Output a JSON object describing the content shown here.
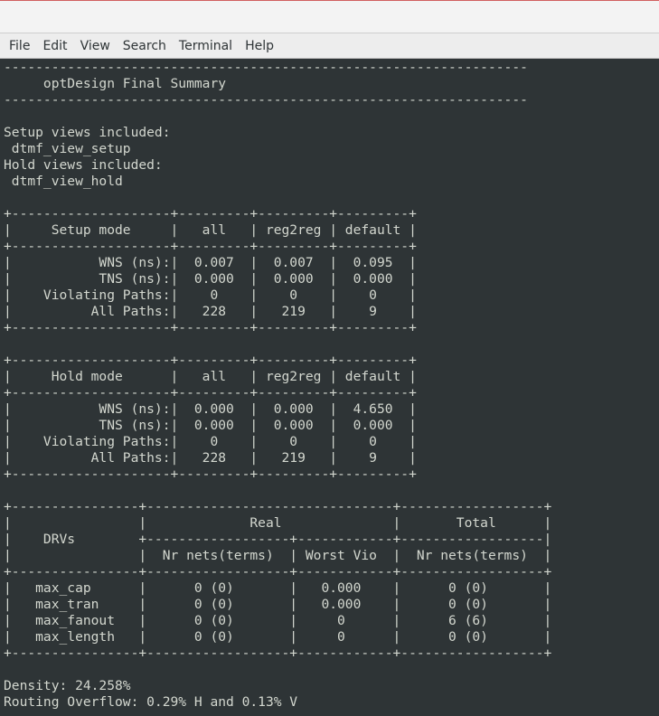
{
  "menu": {
    "items": [
      {
        "label": "File"
      },
      {
        "label": "Edit"
      },
      {
        "label": "View"
      },
      {
        "label": "Search"
      },
      {
        "label": "Terminal"
      },
      {
        "label": "Help"
      }
    ]
  },
  "terminal": {
    "lines": [
      "------------------------------------------------------------------",
      "     optDesign Final Summary",
      "------------------------------------------------------------------",
      "",
      "Setup views included:",
      " dtmf_view_setup",
      "Hold views included:",
      " dtmf_view_hold",
      "",
      "+--------------------+---------+---------+---------+",
      "|     Setup mode     |   all   | reg2reg | default |",
      "+--------------------+---------+---------+---------+",
      "|           WNS (ns):|  0.007  |  0.007  |  0.095  |",
      "|           TNS (ns):|  0.000  |  0.000  |  0.000  |",
      "|    Violating Paths:|    0    |    0    |    0    |",
      "|          All Paths:|   228   |   219   |    9    |",
      "+--------------------+---------+---------+---------+",
      "",
      "+--------------------+---------+---------+---------+",
      "|     Hold mode      |   all   | reg2reg | default |",
      "+--------------------+---------+---------+---------+",
      "|           WNS (ns):|  0.000  |  0.000  |  4.650  |",
      "|           TNS (ns):|  0.000  |  0.000  |  0.000  |",
      "|    Violating Paths:|    0    |    0    |    0    |",
      "|          All Paths:|   228   |   219   |    9    |",
      "+--------------------+---------+---------+---------+",
      "",
      "+----------------+-------------------------------+------------------+",
      "|                |             Real              |       Total      |",
      "|    DRVs        +------------------+------------+------------------|",
      "|                |  Nr nets(terms)  | Worst Vio  |  Nr nets(terms)  |",
      "+----------------+------------------+------------+------------------+",
      "|   max_cap      |      0 (0)       |   0.000    |      0 (0)       |",
      "|   max_tran     |      0 (0)       |   0.000    |      0 (0)       |",
      "|   max_fanout   |      0 (0)       |     0      |      6 (6)       |",
      "|   max_length   |      0 (0)       |     0      |      0 (0)       |",
      "+----------------+------------------+------------+------------------+",
      "",
      "Density: 24.258%",
      "Routing Overflow: 0.29% H and 0.13% V"
    ]
  }
}
